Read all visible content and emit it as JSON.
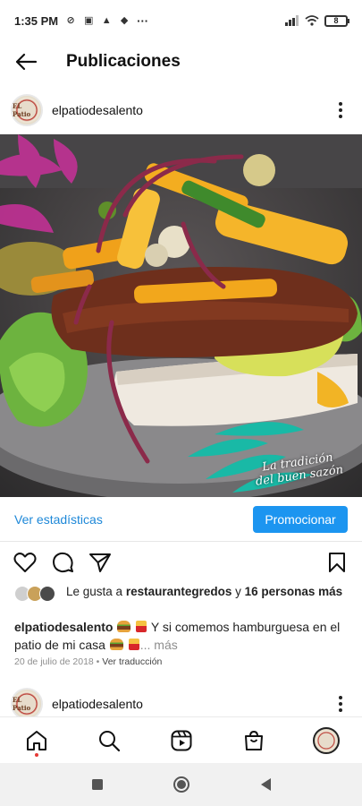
{
  "status_bar": {
    "time": "1:35 PM",
    "more": "···",
    "battery": "8"
  },
  "header": {
    "title": "Publicaciones"
  },
  "post": {
    "username": "elpatiodesalento",
    "avatar_text": "EL Patio",
    "watermark_line1": "La tradición",
    "watermark_line2": "del buen sazón",
    "insights_label": "Ver estadísticas",
    "promote_label": "Promocionar",
    "likes": {
      "prefix": "Le gusta a ",
      "user": "restaurantegredos",
      "connector": " y ",
      "others": "16 personas más"
    },
    "caption": {
      "username": "elpatiodesalento",
      "text_a": " Y si comemos  hamburguesa en el patio de mi casa ",
      "more": "... más"
    },
    "date": "20 de julio de 2018",
    "separator": " • ",
    "translate": "Ver traducción"
  },
  "next_post": {
    "username": "elpatiodesalento"
  },
  "colors": {
    "link": "#1e88d8",
    "promote_bg": "#1c95f0",
    "notification_dot": "#e53935"
  }
}
